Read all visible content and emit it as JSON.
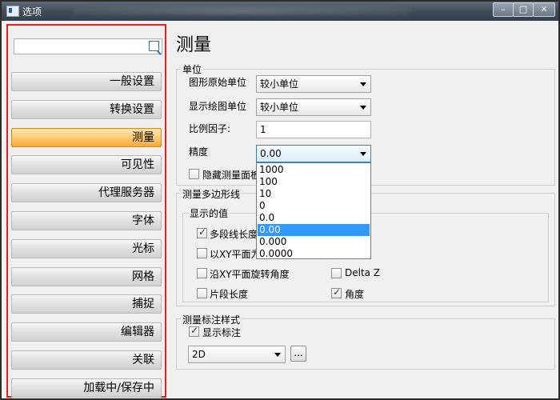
{
  "window": {
    "title": "选项",
    "controls": [
      "–",
      "□",
      "✕"
    ]
  },
  "sidebar": {
    "search_placeholder": "",
    "items": [
      {
        "label": "一般设置",
        "active": false
      },
      {
        "label": "转换设置",
        "active": false
      },
      {
        "label": "测量",
        "active": true
      },
      {
        "label": "可见性",
        "active": false
      },
      {
        "label": "代理服务器",
        "active": false
      },
      {
        "label": "字体",
        "active": false
      },
      {
        "label": "光标",
        "active": false
      },
      {
        "label": "网格",
        "active": false
      },
      {
        "label": "捕捉",
        "active": false
      },
      {
        "label": "编辑器",
        "active": false
      },
      {
        "label": "关联",
        "active": false
      },
      {
        "label": "加载中/保存中",
        "active": false
      }
    ]
  },
  "main": {
    "title": "测量",
    "units": {
      "group_label": "单位",
      "original_unit_label": "图形原始单位",
      "original_unit_value": "较小单位",
      "display_unit_label": "显示绘图单位",
      "display_unit_value": "较小单位",
      "scale_label": "比例因子:",
      "scale_value": "1",
      "precision_label": "精度",
      "precision_value": "0.00",
      "hide_panel_label": "隐藏测量面板",
      "hide_panel_checked": false
    },
    "precision_options": [
      "1000",
      "100",
      "10",
      "0",
      "0.0",
      "0.00",
      "0.000",
      "0.0000"
    ],
    "precision_selected_index": 5,
    "polyline": {
      "group_label": "测量多边形线",
      "display_label": "显示的值",
      "options": [
        {
          "label": "多段线长度",
          "checked": true
        },
        {
          "label": "以XY平面为",
          "checked": false
        },
        {
          "label": "沿XY平面旋转角度",
          "checked": false
        },
        {
          "label": "Delta Z",
          "checked": false
        },
        {
          "label": "片段长度",
          "checked": false
        },
        {
          "label": "角度",
          "checked": true
        }
      ]
    },
    "annotation": {
      "group_label": "测量标注样式",
      "show_label": "显示标注",
      "show_checked": true,
      "style_value": "2D",
      "more_button": "..."
    }
  }
}
